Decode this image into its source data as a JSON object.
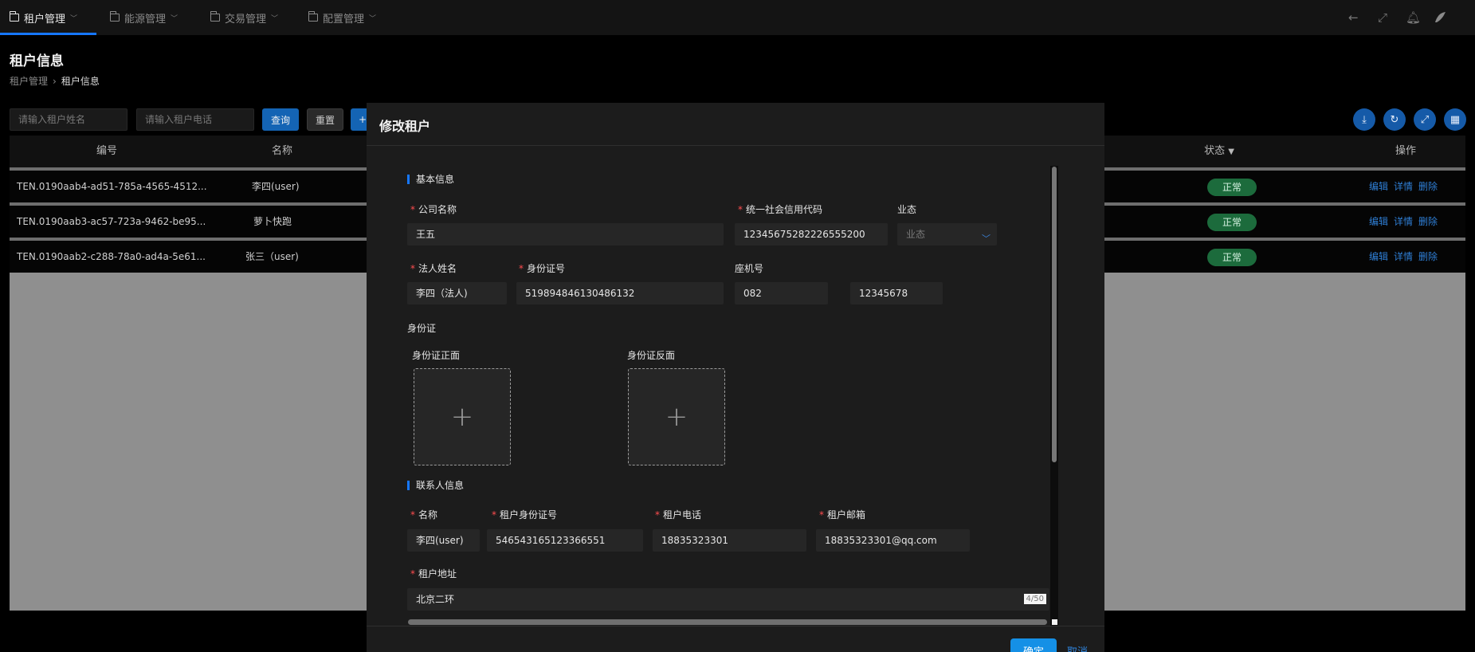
{
  "topnav": {
    "items": [
      {
        "label": "租户管理"
      },
      {
        "label": "能源管理"
      },
      {
        "label": "交易管理"
      },
      {
        "label": "配置管理"
      }
    ],
    "right_icons": [
      "back-icon",
      "fullscreen-icon",
      "bell-icon",
      "avatar"
    ]
  },
  "page": {
    "title": "租户信息",
    "breadcrumb": [
      "租户管理",
      "租户信息"
    ]
  },
  "filters": {
    "name_placeholder": "请输入租户姓名",
    "phone_placeholder": "请输入租户电话",
    "query_label": "查询",
    "reset_label": "重置",
    "add_label": "+"
  },
  "toolbar_icons": [
    "download-icon",
    "refresh-icon",
    "expand-icon",
    "columns-icon"
  ],
  "table": {
    "headers": {
      "id": "编号",
      "name": "名称",
      "status": "状态",
      "ops": "操作"
    },
    "rows": [
      {
        "id": "TEN.0190aab4-ad51-785a-4565-4512...",
        "name": "李四(user)",
        "status": "正常"
      },
      {
        "id": "TEN.0190aab3-ac57-723a-9462-be95...",
        "name": "萝卜快跑",
        "status": "正常"
      },
      {
        "id": "TEN.0190aab2-c288-78a0-ad4a-5e61...",
        "name": "张三（user)",
        "status": "正常"
      }
    ],
    "op_labels": {
      "edit": "编辑",
      "detail": "详情",
      "delete": "删除"
    }
  },
  "modal": {
    "title": "修改租户",
    "basic_section": "基本信息",
    "fields": {
      "company_name": {
        "label": "公司名称",
        "value": "王五"
      },
      "credit_code": {
        "label": "统一社会信用代码",
        "value": "12345675282226555200"
      },
      "business": {
        "label": "业态",
        "placeholder": "业态"
      },
      "legal_name": {
        "label": "法人姓名",
        "value": "李四（法人)"
      },
      "id_number": {
        "label": "身份证号",
        "value": "519894846130486132"
      },
      "landline": {
        "label": "座机号",
        "area": "082",
        "number": "12345678"
      }
    },
    "id_card": {
      "label": "身份证",
      "front": "身份证正面",
      "back": "身份证反面"
    },
    "contact_section": "联系人信息",
    "contact": {
      "name": {
        "label": "名称",
        "value": "李四(user)"
      },
      "tenant_id": {
        "label": "租户身份证号",
        "value": "546543165123366551"
      },
      "phone": {
        "label": "租户电话",
        "value": "18835323301"
      },
      "email": {
        "label": "租户邮箱",
        "value": "18835323301@qq.com"
      },
      "address": {
        "label": "租户地址",
        "value": "北京二环",
        "count": "4/50"
      }
    },
    "confirm_label": "确定",
    "cancel_label": "取消"
  }
}
